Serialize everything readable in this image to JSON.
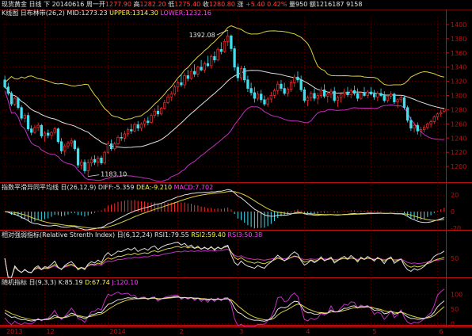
{
  "topbar": {
    "name": "现货黄金",
    "period": "日线",
    "direction": "下",
    "date": "20140616",
    "weekday": "周一",
    "open_label": "开",
    "open": "1277.90",
    "high_label": "高",
    "high": "1282.20",
    "low_label": "低",
    "low": "1275.40",
    "close_label": "收",
    "close": "1280.80",
    "change_label": "涨",
    "change": "+5.40",
    "change_pct": "0.42%",
    "volume_label": "量",
    "volume": "950",
    "amount_label": "额",
    "amount": "1216187",
    "last": "9158"
  },
  "panels": {
    "main": {
      "name": "K线图",
      "indicator": "日布林带",
      "params": "(26,2)",
      "mid": "MID:1273.23",
      "upper": "UPPER:1314.30",
      "lower": "LOWER:1232.16",
      "annot_high": "1392.08",
      "annot_low": "1183.10"
    },
    "macd": {
      "name": "指数平滑异同平均线",
      "params": "日(26,12,9)",
      "diff": "DIFF:-5.359",
      "dea": "DEA:-9.210",
      "macd": "MACD:7.702"
    },
    "rsi": {
      "name": "相对强弱指标(Relative Strenth Index)",
      "params": "日(6,12,24)",
      "rsi1": "RSI1:79.55",
      "rsi2": "RSI2:59.40",
      "rsi3": "RSI3:50.38"
    },
    "kdj": {
      "name": "随机指标",
      "params": "日(9,3,3)",
      "k": "K:85.19",
      "d": "D:67.74",
      "j": "J:120.10"
    }
  },
  "colors": {
    "up": "#ff3030",
    "down": "#40e0f0",
    "upper": "#d8d040",
    "mid": "#e0e0e0",
    "lower": "#c030c0",
    "grid": "#800000",
    "axis": "#c01010"
  },
  "chart_data": [
    {
      "type": "candlestick",
      "title": "K线图 日布林带(26,2)",
      "ylim": [
        1180,
        1410
      ],
      "y_ticks": [
        "1400",
        "1380",
        "1360",
        "1340",
        "1320",
        "1300",
        "1280",
        "1260",
        "1240",
        "1220",
        "1200"
      ],
      "x_ticks": [
        "2013",
        "12",
        "2014",
        "2",
        "3",
        "4",
        "5",
        "6"
      ],
      "x_tick_index": [
        0,
        12,
        31,
        52,
        70,
        90,
        110,
        130
      ],
      "ohlc": [
        [
          1322,
          1328,
          1310,
          1312
        ],
        [
          1312,
          1318,
          1300,
          1303
        ],
        [
          1303,
          1306,
          1285,
          1288
        ],
        [
          1288,
          1298,
          1285,
          1296
        ],
        [
          1296,
          1298,
          1280,
          1283
        ],
        [
          1283,
          1286,
          1265,
          1268
        ],
        [
          1268,
          1275,
          1262,
          1272
        ],
        [
          1272,
          1276,
          1250,
          1253
        ],
        [
          1253,
          1258,
          1244,
          1248
        ],
        [
          1248,
          1258,
          1246,
          1255
        ],
        [
          1255,
          1262,
          1250,
          1258
        ],
        [
          1258,
          1260,
          1240,
          1243
        ],
        [
          1243,
          1250,
          1235,
          1247
        ],
        [
          1247,
          1252,
          1240,
          1244
        ],
        [
          1244,
          1250,
          1238,
          1248
        ],
        [
          1248,
          1256,
          1245,
          1253
        ],
        [
          1253,
          1255,
          1232,
          1235
        ],
        [
          1235,
          1240,
          1218,
          1222
        ],
        [
          1222,
          1232,
          1215,
          1229
        ],
        [
          1229,
          1236,
          1225,
          1233
        ],
        [
          1233,
          1240,
          1228,
          1236
        ],
        [
          1236,
          1238,
          1222,
          1225
        ],
        [
          1225,
          1228,
          1198,
          1202
        ],
        [
          1202,
          1210,
          1196,
          1206
        ],
        [
          1206,
          1210,
          1190,
          1194
        ],
        [
          1194,
          1210,
          1186,
          1205
        ],
        [
          1205,
          1214,
          1200,
          1210
        ],
        [
          1210,
          1216,
          1202,
          1206
        ],
        [
          1206,
          1215,
          1200,
          1212
        ],
        [
          1212,
          1215,
          1202,
          1205
        ],
        [
          1205,
          1222,
          1203,
          1220
        ],
        [
          1220,
          1236,
          1218,
          1232
        ],
        [
          1232,
          1238,
          1222,
          1225
        ],
        [
          1225,
          1235,
          1222,
          1232
        ],
        [
          1232,
          1244,
          1230,
          1241
        ],
        [
          1241,
          1248,
          1236,
          1240
        ],
        [
          1240,
          1250,
          1235,
          1246
        ],
        [
          1246,
          1255,
          1242,
          1252
        ],
        [
          1252,
          1260,
          1246,
          1250
        ],
        [
          1250,
          1262,
          1248,
          1259
        ],
        [
          1259,
          1264,
          1250,
          1254
        ],
        [
          1254,
          1262,
          1250,
          1260
        ],
        [
          1260,
          1268,
          1255,
          1264
        ],
        [
          1264,
          1270,
          1258,
          1262
        ],
        [
          1262,
          1275,
          1260,
          1272
        ],
        [
          1272,
          1282,
          1268,
          1278
        ],
        [
          1278,
          1286,
          1270,
          1274
        ],
        [
          1274,
          1284,
          1272,
          1282
        ],
        [
          1282,
          1294,
          1280,
          1290
        ],
        [
          1290,
          1302,
          1288,
          1298
        ],
        [
          1298,
          1306,
          1292,
          1302
        ],
        [
          1302,
          1315,
          1300,
          1312
        ],
        [
          1312,
          1322,
          1305,
          1318
        ],
        [
          1318,
          1330,
          1312,
          1315
        ],
        [
          1315,
          1332,
          1310,
          1328
        ],
        [
          1328,
          1336,
          1320,
          1324
        ],
        [
          1324,
          1338,
          1322,
          1334
        ],
        [
          1334,
          1344,
          1326,
          1330
        ],
        [
          1330,
          1342,
          1326,
          1340
        ],
        [
          1340,
          1350,
          1334,
          1336
        ],
        [
          1336,
          1348,
          1332,
          1345
        ],
        [
          1345,
          1356,
          1340,
          1342
        ],
        [
          1342,
          1358,
          1338,
          1355
        ],
        [
          1355,
          1362,
          1346,
          1350
        ],
        [
          1350,
          1368,
          1348,
          1365
        ],
        [
          1365,
          1375,
          1358,
          1362
        ],
        [
          1362,
          1380,
          1360,
          1376
        ],
        [
          1376,
          1392,
          1370,
          1384
        ],
        [
          1384,
          1386,
          1362,
          1366
        ],
        [
          1366,
          1370,
          1335,
          1340
        ],
        [
          1340,
          1345,
          1320,
          1325
        ],
        [
          1325,
          1342,
          1322,
          1338
        ],
        [
          1338,
          1342,
          1318,
          1322
        ],
        [
          1322,
          1328,
          1305,
          1310
        ],
        [
          1310,
          1318,
          1300,
          1304
        ],
        [
          1304,
          1312,
          1290,
          1296
        ],
        [
          1296,
          1306,
          1292,
          1302
        ],
        [
          1302,
          1308,
          1290,
          1294
        ],
        [
          1294,
          1300,
          1285,
          1288
        ],
        [
          1288,
          1298,
          1284,
          1295
        ],
        [
          1295,
          1305,
          1290,
          1300
        ],
        [
          1300,
          1310,
          1296,
          1307
        ],
        [
          1307,
          1320,
          1302,
          1316
        ],
        [
          1316,
          1322,
          1306,
          1310
        ],
        [
          1310,
          1318,
          1300,
          1303
        ],
        [
          1303,
          1312,
          1298,
          1309
        ],
        [
          1309,
          1322,
          1305,
          1318
        ],
        [
          1318,
          1330,
          1312,
          1326
        ],
        [
          1326,
          1334,
          1318,
          1322
        ],
        [
          1322,
          1328,
          1305,
          1308
        ],
        [
          1308,
          1312,
          1290,
          1293
        ],
        [
          1293,
          1300,
          1285,
          1297
        ],
        [
          1297,
          1306,
          1292,
          1303
        ],
        [
          1303,
          1310,
          1292,
          1296
        ],
        [
          1296,
          1304,
          1288,
          1300
        ],
        [
          1300,
          1312,
          1296,
          1308
        ],
        [
          1308,
          1316,
          1296,
          1299
        ],
        [
          1299,
          1306,
          1290,
          1302
        ],
        [
          1302,
          1310,
          1296,
          1306
        ],
        [
          1306,
          1312,
          1290,
          1293
        ],
        [
          1293,
          1300,
          1284,
          1297
        ],
        [
          1297,
          1304,
          1290,
          1302
        ],
        [
          1302,
          1310,
          1296,
          1305
        ],
        [
          1305,
          1312,
          1298,
          1301
        ],
        [
          1301,
          1310,
          1296,
          1307
        ],
        [
          1307,
          1314,
          1300,
          1303
        ],
        [
          1303,
          1310,
          1292,
          1296
        ],
        [
          1296,
          1306,
          1294,
          1304
        ],
        [
          1304,
          1312,
          1298,
          1300
        ],
        [
          1300,
          1308,
          1296,
          1305
        ],
        [
          1305,
          1312,
          1300,
          1302
        ],
        [
          1302,
          1308,
          1294,
          1298
        ],
        [
          1298,
          1306,
          1292,
          1303
        ],
        [
          1303,
          1310,
          1298,
          1300
        ],
        [
          1300,
          1306,
          1290,
          1293
        ],
        [
          1293,
          1302,
          1290,
          1299
        ],
        [
          1299,
          1306,
          1295,
          1302
        ],
        [
          1302,
          1304,
          1288,
          1291
        ],
        [
          1291,
          1296,
          1282,
          1294
        ],
        [
          1294,
          1300,
          1290,
          1297
        ],
        [
          1297,
          1300,
          1280,
          1283
        ],
        [
          1283,
          1286,
          1262,
          1265
        ],
        [
          1265,
          1270,
          1250,
          1254
        ],
        [
          1254,
          1262,
          1248,
          1258
        ],
        [
          1258,
          1262,
          1245,
          1250
        ],
        [
          1250,
          1256,
          1242,
          1252
        ],
        [
          1252,
          1258,
          1248,
          1255
        ],
        [
          1255,
          1262,
          1252,
          1260
        ],
        [
          1260,
          1266,
          1255,
          1263
        ],
        [
          1263,
          1272,
          1260,
          1270
        ],
        [
          1270,
          1276,
          1266,
          1274
        ],
        [
          1274,
          1280,
          1270,
          1276
        ],
        [
          1277.9,
          1282.2,
          1275.4,
          1280.8
        ]
      ]
    },
    {
      "type": "macd",
      "ylim": [
        -22,
        24
      ],
      "y_ticks": [
        "20",
        "0",
        "-20"
      ]
    },
    {
      "type": "line",
      "name": "RSI",
      "ylim": [
        0,
        100
      ],
      "y_ticks": [
        "50"
      ]
    },
    {
      "type": "line",
      "name": "KDJ",
      "ylim": [
        -10,
        125
      ],
      "y_ticks": [
        "100",
        "50",
        "0"
      ]
    }
  ]
}
